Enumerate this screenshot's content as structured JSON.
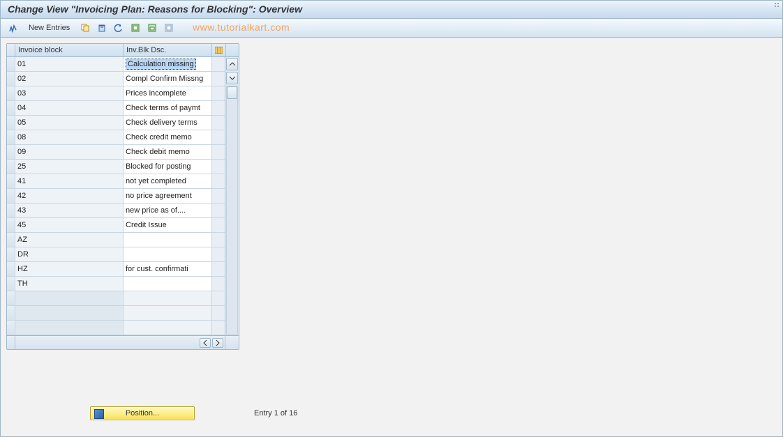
{
  "title": "Change View \"Invoicing Plan: Reasons for Blocking\": Overview",
  "toolbar": {
    "new_entries_label": "New Entries"
  },
  "watermark": "www.tutorialkart.com",
  "table": {
    "headers": {
      "col1": "Invoice block",
      "col2": "Inv.Blk Dsc."
    },
    "rows": [
      {
        "code": "01",
        "desc": "Calculation missing",
        "selected": true
      },
      {
        "code": "02",
        "desc": "Compl Confirm Missng"
      },
      {
        "code": "03",
        "desc": "Prices incomplete"
      },
      {
        "code": "04",
        "desc": "Check terms of paymt"
      },
      {
        "code": "05",
        "desc": "Check delivery terms"
      },
      {
        "code": "08",
        "desc": "Check credit memo"
      },
      {
        "code": "09",
        "desc": "Check debit memo"
      },
      {
        "code": "25",
        "desc": "Blocked for posting"
      },
      {
        "code": "41",
        "desc": "not yet completed"
      },
      {
        "code": "42",
        "desc": "no price agreement"
      },
      {
        "code": "43",
        "desc": "new price as of...."
      },
      {
        "code": "45",
        "desc": "Credit Issue"
      },
      {
        "code": "AZ",
        "desc": ""
      },
      {
        "code": "DR",
        "desc": ""
      },
      {
        "code": "HZ",
        "desc": "for cust. confirmati"
      },
      {
        "code": "TH",
        "desc": ""
      }
    ],
    "empty_rows": 3
  },
  "footer": {
    "position_label": "Position...",
    "entry_text": "Entry 1 of 16"
  }
}
